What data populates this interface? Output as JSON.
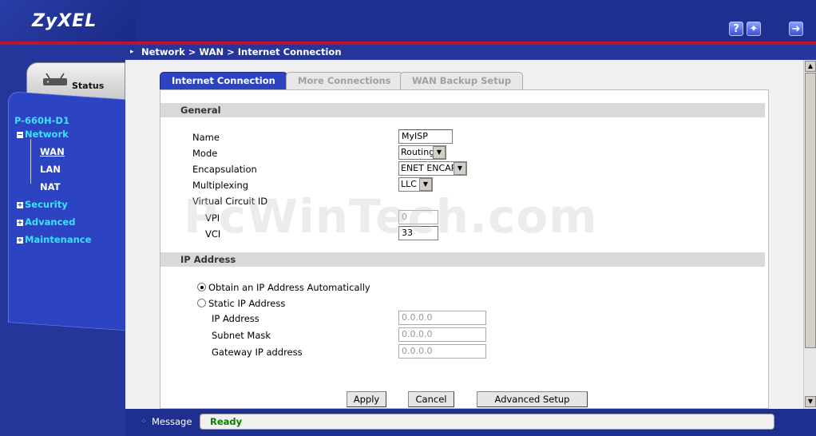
{
  "header": {
    "logo": "ZyXEL",
    "icons": [
      "help-icon",
      "wizard-icon",
      "logout-icon"
    ]
  },
  "sidebar": {
    "status_label": "Status",
    "device": "P-660H-D1",
    "items": [
      {
        "label": "Network",
        "expanded": true
      },
      {
        "label": "WAN",
        "selected": true
      },
      {
        "label": "LAN"
      },
      {
        "label": "NAT"
      },
      {
        "label": "Security",
        "expanded": false
      },
      {
        "label": "Advanced",
        "expanded": false
      },
      {
        "label": "Maintenance",
        "expanded": false
      }
    ]
  },
  "breadcrumb": "Network > WAN > Internet Connection",
  "tabs": [
    {
      "label": "Internet Connection",
      "active": true
    },
    {
      "label": "More Connections"
    },
    {
      "label": "WAN Backup Setup"
    }
  ],
  "general": {
    "title": "General",
    "name_label": "Name",
    "name_value": "MyISP",
    "mode_label": "Mode",
    "mode_value": "Routing",
    "encap_label": "Encapsulation",
    "encap_value": "ENET ENCAP",
    "mux_label": "Multiplexing",
    "mux_value": "LLC",
    "vc_label": "Virtual Circuit ID",
    "vpi_label": "VPI",
    "vpi_value": "0",
    "vci_label": "VCI",
    "vci_value": "33"
  },
  "ip": {
    "title": "IP Address",
    "auto_label": "Obtain an IP Address Automatically",
    "static_label": "Static IP Address",
    "selected": "auto",
    "ip_label": "IP Address",
    "ip_value": "0.0.0.0",
    "mask_label": "Subnet Mask",
    "mask_value": "0.0.0.0",
    "gw_label": "Gateway IP address",
    "gw_value": "0.0.0.0"
  },
  "buttons": {
    "apply": "Apply",
    "cancel": "Cancel",
    "advanced": "Advanced Setup"
  },
  "status": {
    "label": "Message",
    "value": "Ready"
  },
  "watermark": "PcWinTech.com",
  "colors": {
    "header_blue": "#1e2f8f",
    "accent_red": "#c8102e",
    "nav_cyan": "#3fe0ff",
    "ready_green": "#0a7f00"
  }
}
